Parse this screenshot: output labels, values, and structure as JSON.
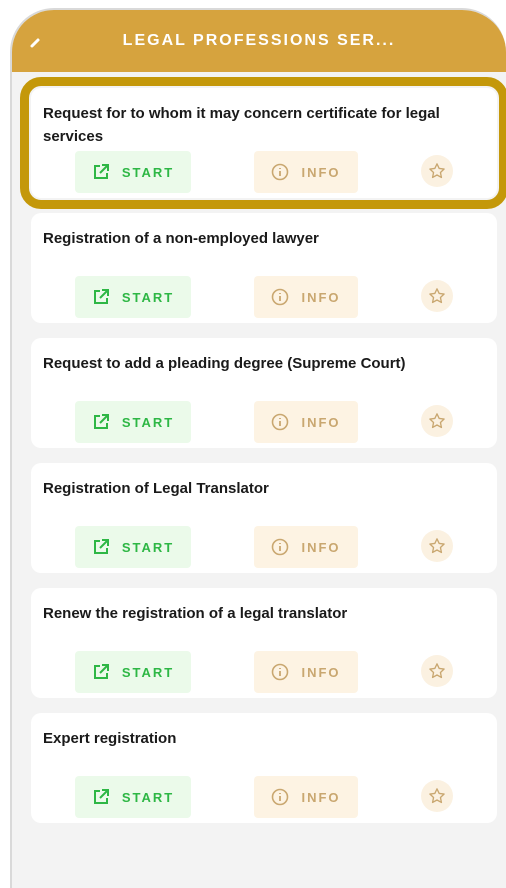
{
  "header": {
    "title": "LEGAL PROFESSIONS SER..."
  },
  "services": [
    {
      "title": "Request for to whom it may concern certificate for legal services",
      "start_label": "START",
      "info_label": "INFO"
    },
    {
      "title": "Registration of a non-employed lawyer",
      "start_label": "START",
      "info_label": "INFO"
    },
    {
      "title": "Request to add a pleading degree (Supreme Court)",
      "start_label": "START",
      "info_label": "INFO"
    },
    {
      "title": "Registration of Legal Translator",
      "start_label": "START",
      "info_label": "INFO"
    },
    {
      "title": "Renew the registration of a legal translator",
      "start_label": "START",
      "info_label": "INFO"
    },
    {
      "title": "Expert registration",
      "start_label": "START",
      "info_label": "INFO"
    }
  ],
  "icons": {
    "back": "chevron-left-icon",
    "start": "external-link-icon",
    "info": "info-circle-icon",
    "favorite": "star-outline-icon"
  },
  "colors": {
    "header": "#d6a33e",
    "highlight": "#c4980a",
    "start": "#2eb745",
    "info": "#c9a770"
  }
}
